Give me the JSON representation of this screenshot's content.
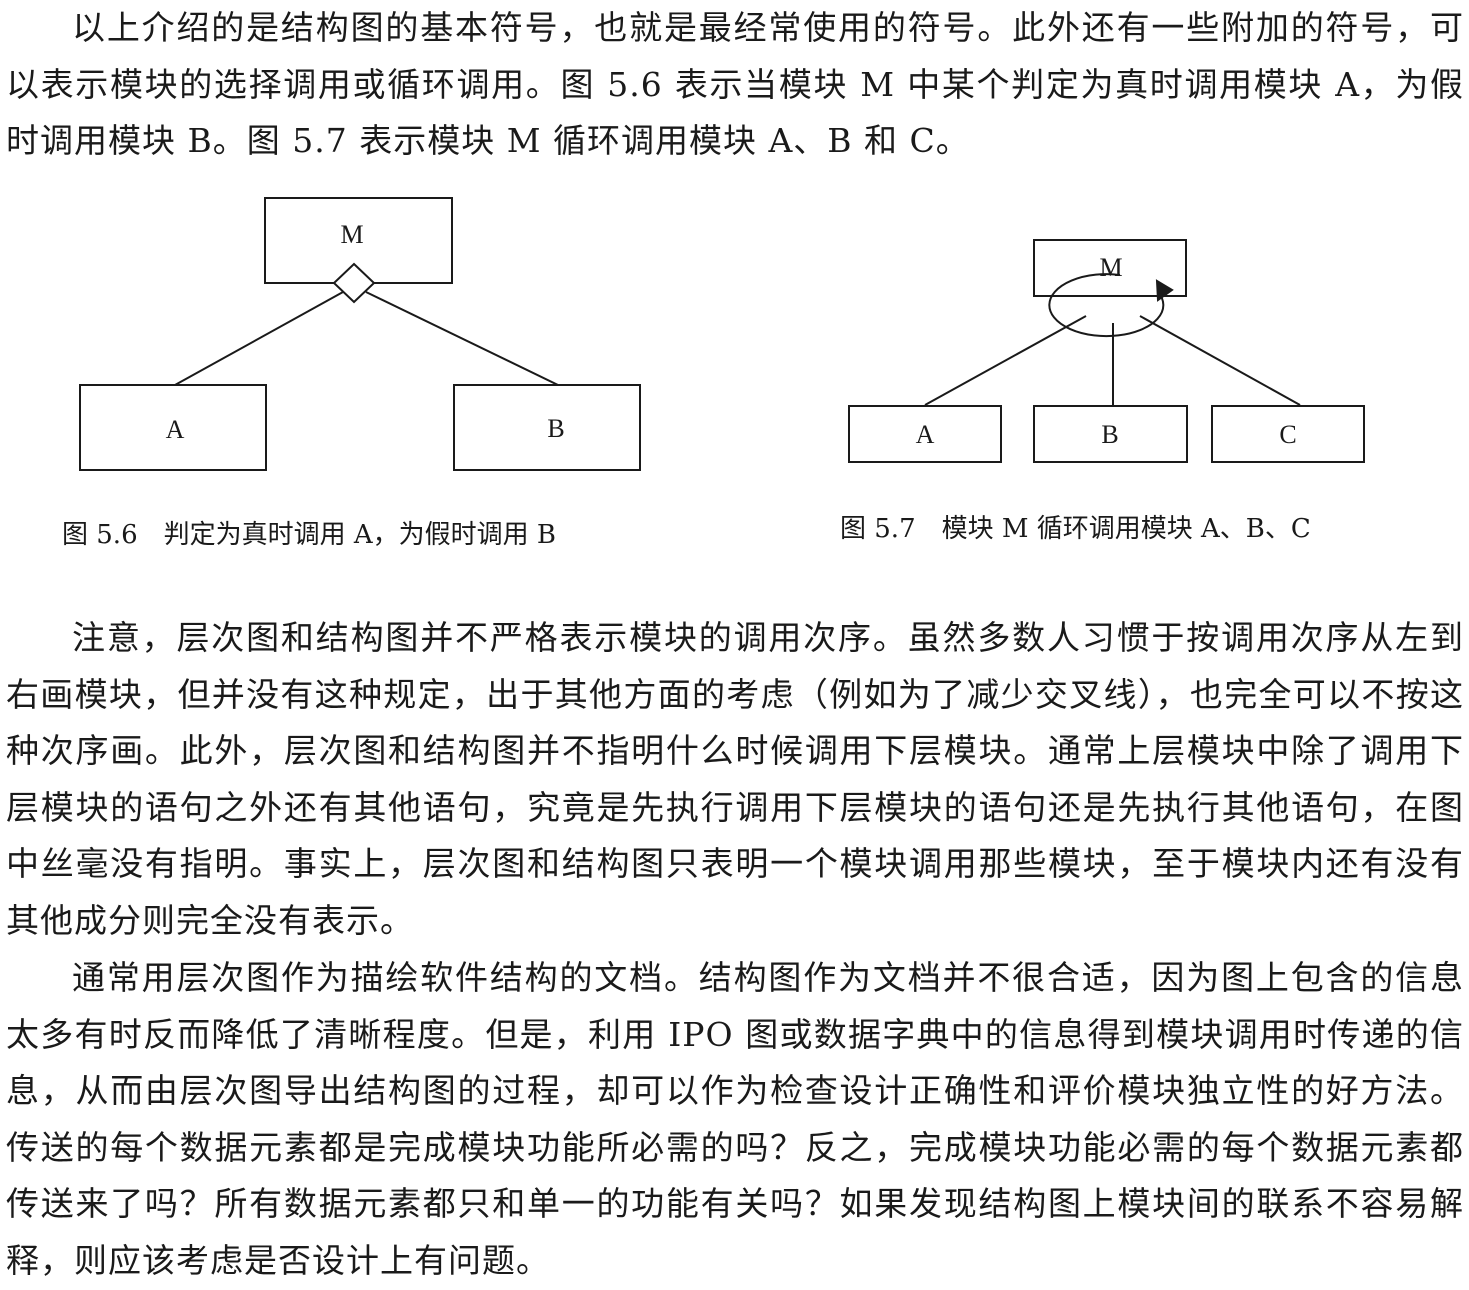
{
  "paragraphs": [
    "以上介绍的是结构图的基本符号，也就是最经常使用的符号。此外还有一些附加的符号，可以表示模块的选择调用或循环调用。图 5.6 表示当模块 M 中某个判定为真时调用模块 A，为假时调用模块 B。图 5.7 表示模块 M 循环调用模块 A、B 和 C。",
    "注意，层次图和结构图并不严格表示模块的调用次序。虽然多数人习惯于按调用次序从左到右画模块，但并没有这种规定，出于其他方面的考虑（例如为了减少交叉线），也完全可以不按这种次序画。此外，层次图和结构图并不指明什么时候调用下层模块。通常上层模块中除了调用下层模块的语句之外还有其他语句，究竟是先执行调用下层模块的语句还是先执行其他语句，在图中丝毫没有指明。事实上，层次图和结构图只表明一个模块调用那些模块，至于模块内还有没有其他成分则完全没有表示。",
    "通常用层次图作为描绘软件结构的文档。结构图作为文档并不很合适，因为图上包含的信息太多有时反而降低了清晰程度。但是，利用 IPO 图或数据字典中的信息得到模块调用时传递的信息，从而由层次图导出结构图的过程，却可以作为检查设计正确性和评价模块独立性的好方法。传送的每个数据元素都是完成模块功能所必需的吗？反之，完成模块功能必需的每个数据元素都传送来了吗？所有数据元素都只和单一的功能有关吗？如果发现结构图上模块间的联系不容易解释，则应该考虑是否设计上有问题。"
  ],
  "figure_5_6": {
    "top_module": "M",
    "left_module": "A",
    "right_module": "B",
    "caption": "图 5.6　判定为真时调用 A，为假时调用 B"
  },
  "figure_5_7": {
    "top_module": "M",
    "modules": [
      "A",
      "B",
      "C"
    ],
    "caption": "图 5.7　模块 M 循环调用模块 A、B、C"
  },
  "colors": {
    "ink": "#1a1a1a",
    "paper": "#ffffff"
  }
}
